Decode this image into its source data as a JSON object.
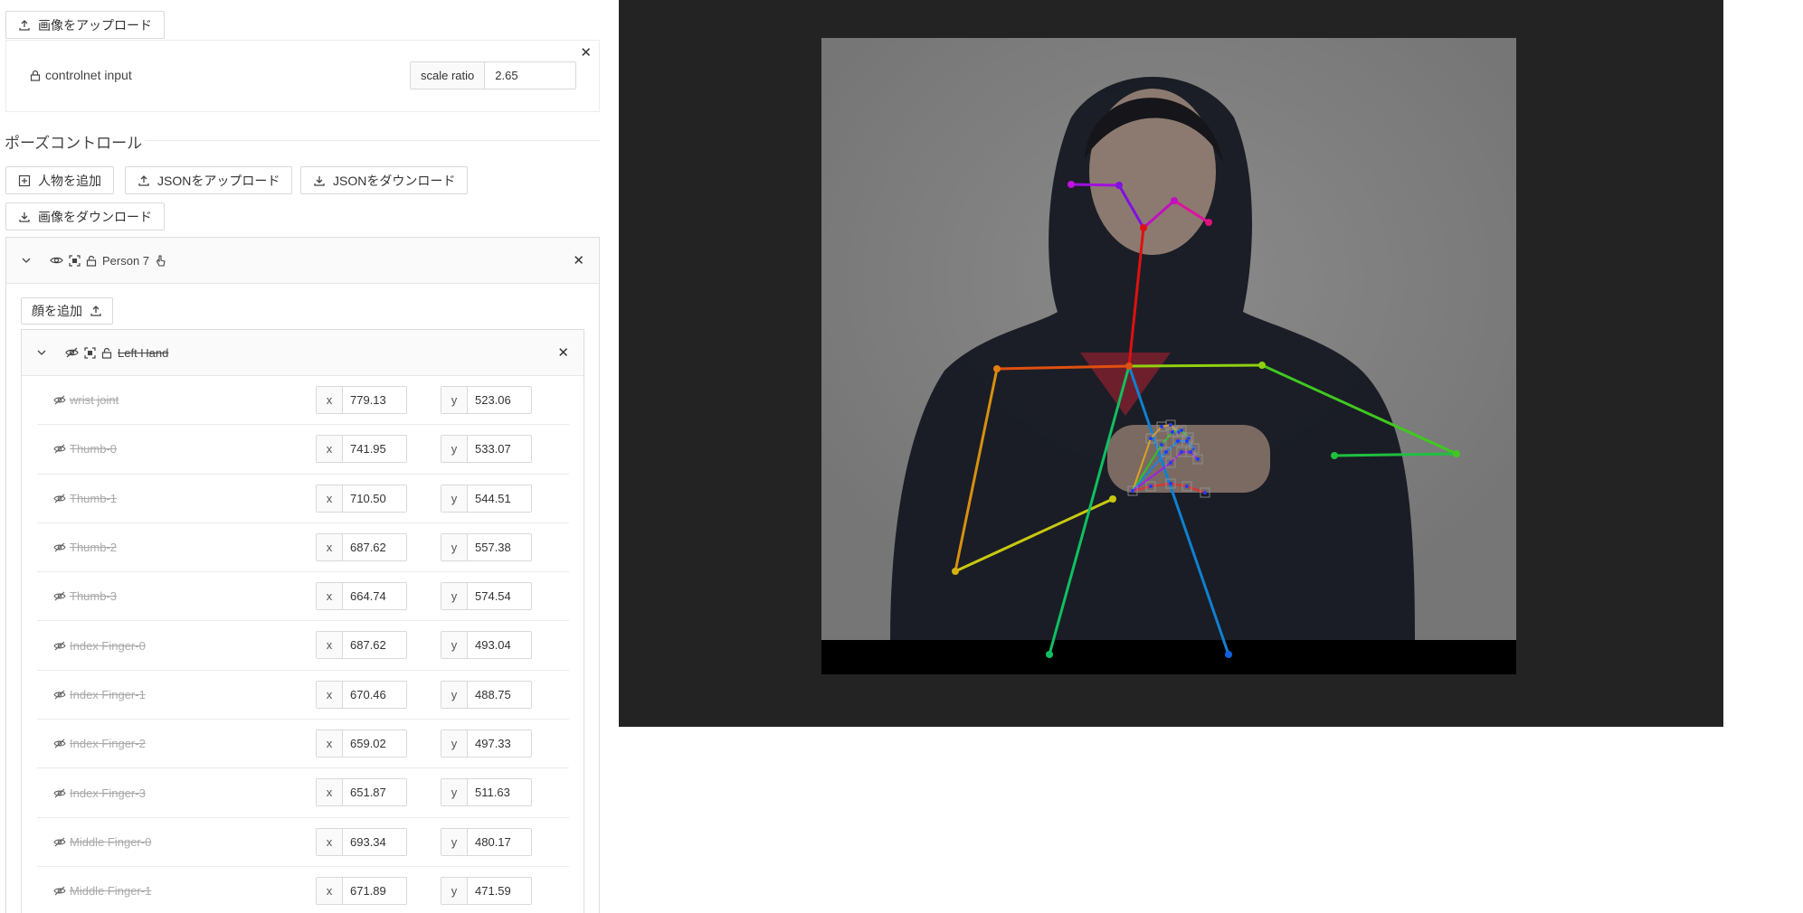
{
  "toolbar": {
    "upload_image": "画像をアップロード",
    "controlnet_input": "controlnet input",
    "scale_ratio_label": "scale ratio",
    "scale_ratio_value": "2.65"
  },
  "pose_control": {
    "section_title": "ポーズコントロール",
    "add_person": "人物を追加",
    "upload_json": "JSONをアップロード",
    "download_json": "JSONをダウンロード",
    "download_image": "画像をダウンロード"
  },
  "person": {
    "name": "Person 7",
    "add_face": "顔を追加",
    "hand": {
      "name": "Left Hand",
      "keypoints": [
        {
          "name": "wrist joint",
          "x": "779.13",
          "y": "523.06"
        },
        {
          "name": "Thumb-0",
          "x": "741.95",
          "y": "533.07"
        },
        {
          "name": "Thumb-1",
          "x": "710.50",
          "y": "544.51"
        },
        {
          "name": "Thumb-2",
          "x": "687.62",
          "y": "557.38"
        },
        {
          "name": "Thumb-3",
          "x": "664.74",
          "y": "574.54"
        },
        {
          "name": "Index Finger-0",
          "x": "687.62",
          "y": "493.04"
        },
        {
          "name": "Index Finger-1",
          "x": "670.46",
          "y": "488.75"
        },
        {
          "name": "Index Finger-2",
          "x": "659.02",
          "y": "497.33"
        },
        {
          "name": "Index Finger-3",
          "x": "651.87",
          "y": "511.63"
        },
        {
          "name": "Middle Finger-0",
          "x": "693.34",
          "y": "480.17"
        },
        {
          "name": "Middle Finger-1",
          "x": "671.89",
          "y": "471.59"
        }
      ]
    }
  },
  "colors": {
    "canvas_bg": "#232323",
    "photo_overlay": "#7a7a7a"
  }
}
